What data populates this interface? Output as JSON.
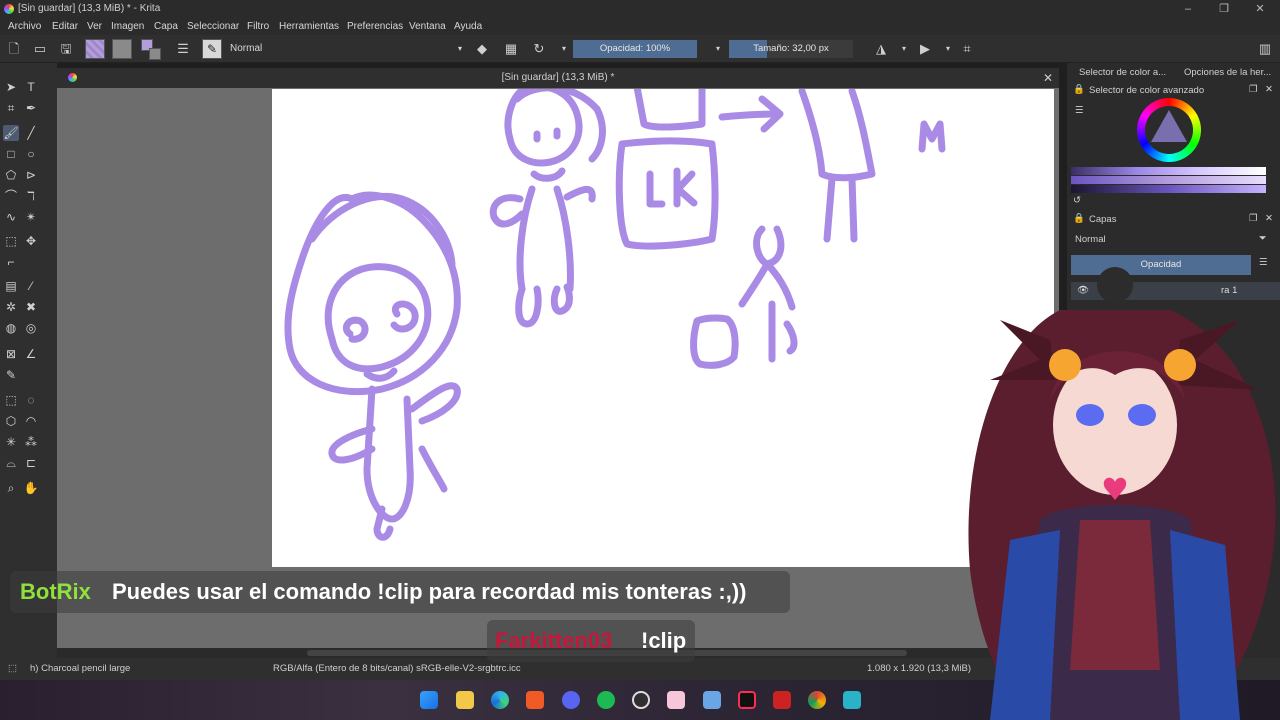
{
  "window": {
    "title": "[Sin guardar]  (13,3 MiB) * - Krita",
    "minimize": "–",
    "maximize": "❐",
    "close": "✕"
  },
  "menu": [
    "Archivo",
    "Editar",
    "Ver",
    "Imagen",
    "Capa",
    "Seleccionar",
    "Filtro",
    "Herramientas",
    "Preferencias",
    "Ventana",
    "Ayuda"
  ],
  "toolbar": {
    "blend_mode": "Normal",
    "opacity_label": "Opacidad: 100%",
    "opacity_fraction": 1.0,
    "size_label": "Tamaño: 32,00 px",
    "foreground_color": "#b39ddb",
    "background_color": "#8a8a8a"
  },
  "document": {
    "tab_title": "[Sin guardar]  (13,3 MiB) *",
    "stroke_color": "#a98be6"
  },
  "dockers": {
    "tab_color": "Selector de color a...",
    "tab_tool_options": "Opciones de la her...",
    "color_selector_title": "Selector de color avanzado",
    "layers_title": "Capas",
    "layer_blend": "Normal",
    "layer_opacity": "Opacidad",
    "layer_name": "ra 1"
  },
  "status": {
    "brush": "h) Charcoal pencil large",
    "color_space": "RGB/Alfa (Entero de 8 bits/canal)  sRGB-elle-V2-srgbtrc.icc",
    "dimensions": "1.080 x 1.920 (13,3 MiB)"
  },
  "overlay": {
    "chat1_user": "BotRix",
    "chat1_msg": "Puedes usar el comando !clip para recordad mis tonteras :,))",
    "chat2_user": "Farkitten03",
    "chat2_msg": "!clip"
  },
  "taskbar": {
    "icons": [
      "windows-start-icon",
      "file-explorer-icon",
      "edge-browser-icon",
      "brave-browser-icon",
      "discord-icon",
      "spotify-icon",
      "obs-icon",
      "paint-icon",
      "vscode-icon",
      "tiktok-icon",
      "vtube-icon",
      "chrome-icon",
      "krita-taskbar-icon"
    ]
  }
}
